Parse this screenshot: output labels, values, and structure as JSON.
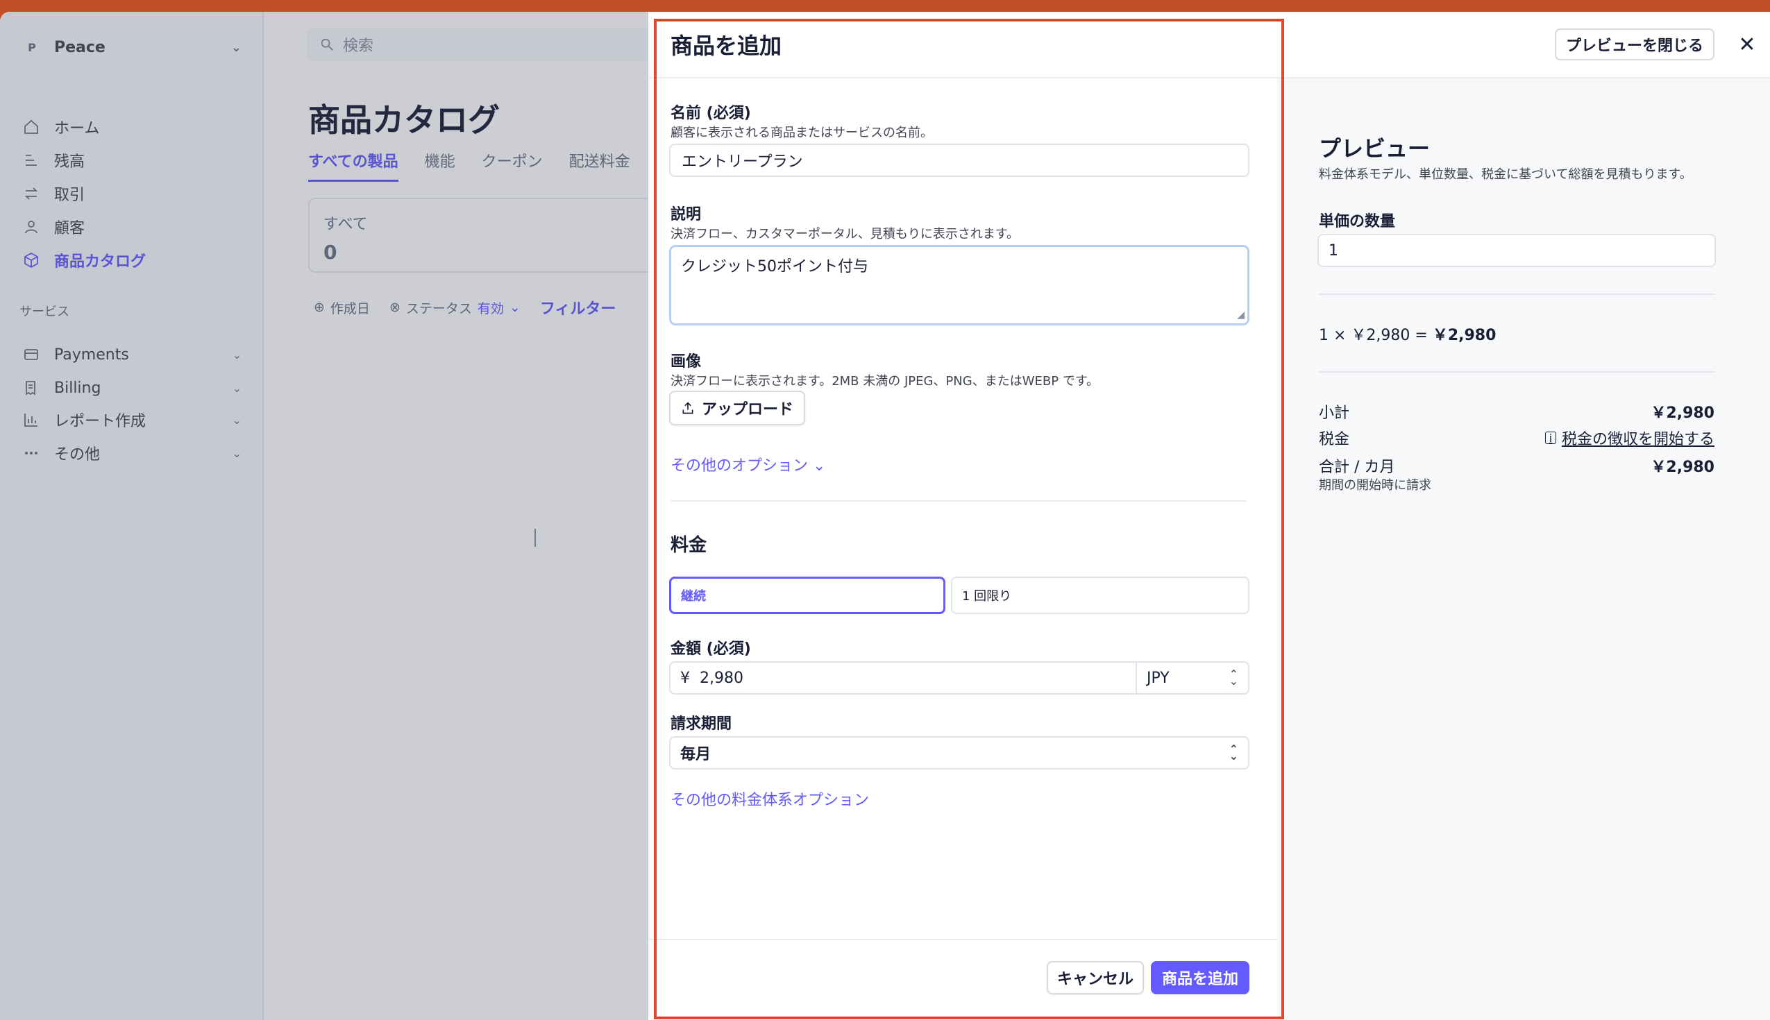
{
  "sidebar": {
    "account_initial": "P",
    "account_name": "Peace",
    "nav": [
      {
        "label": "ホーム",
        "icon": "home-icon"
      },
      {
        "label": "残高",
        "icon": "balance-icon"
      },
      {
        "label": "取引",
        "icon": "transactions-icon"
      },
      {
        "label": "顧客",
        "icon": "user-icon"
      },
      {
        "label": "商品カタログ",
        "icon": "box-icon",
        "active": true
      }
    ],
    "section_label": "サービス",
    "services": [
      {
        "label": "Payments",
        "icon": "card-icon"
      },
      {
        "label": "Billing",
        "icon": "billing-icon"
      },
      {
        "label": "レポート作成",
        "icon": "chart-icon"
      },
      {
        "label": "その他",
        "icon": "more-icon"
      }
    ]
  },
  "main": {
    "search_placeholder": "検索",
    "page_title": "商品カタログ",
    "tabs": [
      "すべての製品",
      "機能",
      "クーポン",
      "配送料金"
    ],
    "stat_label": "すべて",
    "stat_value": "0",
    "filters": {
      "created": "作成日",
      "status": "ステータス",
      "status_value": "有効",
      "more_link": "フィルター"
    }
  },
  "form": {
    "title": "商品を追加",
    "name_label": "名前 (必須)",
    "name_help": "顧客に表示される商品またはサービスの名前。",
    "name_value": "エントリープラン",
    "desc_label": "説明",
    "desc_help": "決済フロー、カスタマーポータル、見積もりに表示されます。",
    "desc_value": "クレジット50ポイント付与",
    "image_label": "画像",
    "image_help": "決済フローに表示されます。2MB 未満の JPEG、PNG、またはWEBP です。",
    "upload_label": "アップロード",
    "more_options": "その他のオプション",
    "pricing_title": "料金",
    "recurring": "継続",
    "one_time": "1 回限り",
    "amount_label": "金額 (必須)",
    "currency_symbol": "¥",
    "amount_value": "2,980",
    "currency": "JPY",
    "period_label": "請求期間",
    "period_value": "毎月",
    "more_pricing": "その他の料金体系オプション",
    "cancel": "キャンセル",
    "submit": "商品を追加"
  },
  "preview": {
    "close_button": "プレビューを閉じる",
    "title": "プレビュー",
    "subtitle": "料金体系モデル、単位数量、税金に基づいて総額を見積もります。",
    "qty_label": "単価の数量",
    "qty_value": "1",
    "calc_prefix": "1 × ￥2,980 = ",
    "calc_total": "￥2,980",
    "subtotal_label": "小計",
    "subtotal_value": "￥2,980",
    "tax_label": "税金",
    "tax_link": "税金の徴収を開始する",
    "total_label": "合計 / カ月",
    "total_value": "￥2,980",
    "total_note": "期間の開始時に請求"
  },
  "colors": {
    "accent": "#635bff",
    "highlight": "#e0472f",
    "top_bar": "#c24f25"
  }
}
